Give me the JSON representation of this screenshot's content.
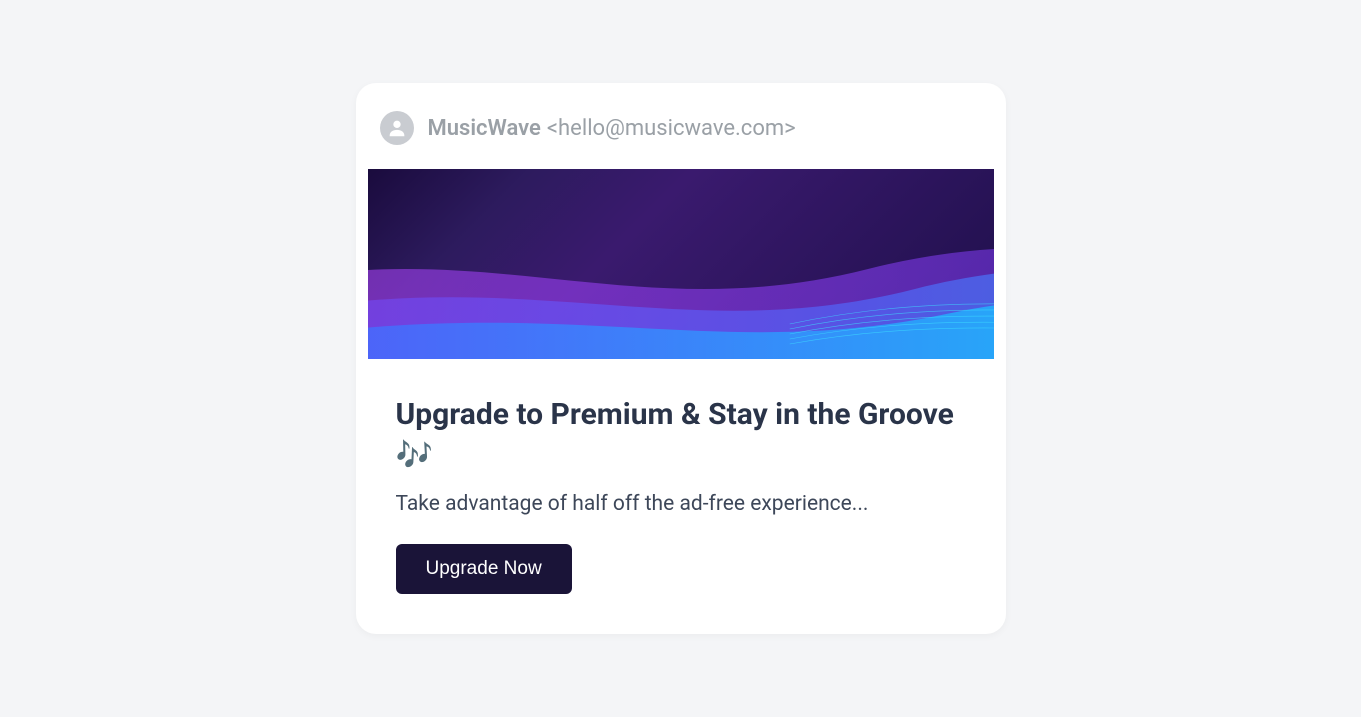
{
  "sender": {
    "name": "MusicWave",
    "email": "<hello@musicwave.com>"
  },
  "title": "Upgrade to Premium & Stay in the Groove 🎶",
  "body": "Take advantage of half off the ad-free experience...",
  "button": "Upgrade Now"
}
